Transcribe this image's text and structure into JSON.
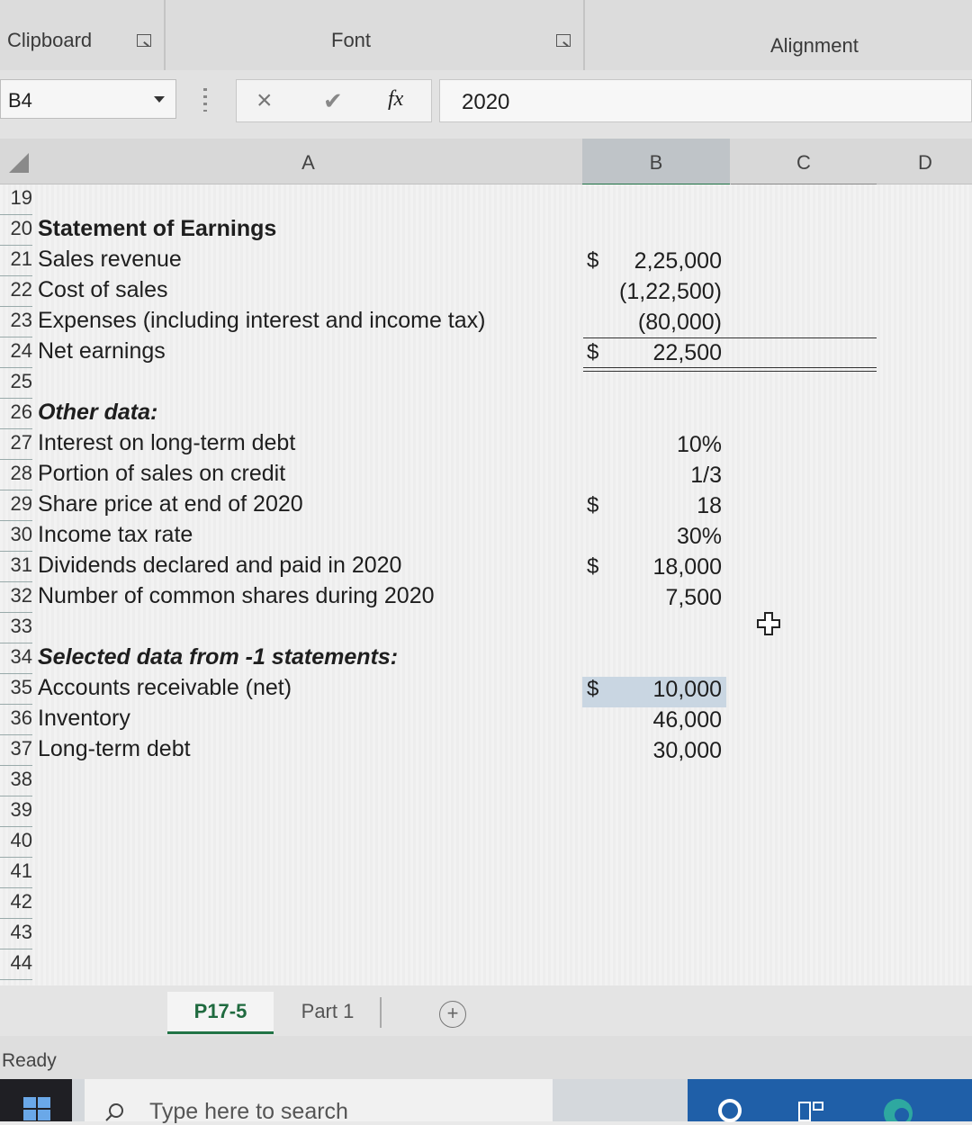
{
  "ribbon": {
    "groups": [
      {
        "label": "Clipboard"
      },
      {
        "label": "Font"
      },
      {
        "label": "Alignment"
      }
    ]
  },
  "formula_bar": {
    "name_box": "B4",
    "cancel_icon": "×",
    "enter_icon": "✔",
    "fx_icon": "fx",
    "value": "2020"
  },
  "columns": [
    "A",
    "B",
    "C",
    "D"
  ],
  "rows": [
    {
      "num": "19",
      "label": "",
      "style": "",
      "dollar": "",
      "value": ""
    },
    {
      "num": "20",
      "label": "Statement of Earnings",
      "style": "bold",
      "dollar": "",
      "value": ""
    },
    {
      "num": "21",
      "label": "Sales revenue",
      "style": "",
      "dollar": "$",
      "value": "2,25,000"
    },
    {
      "num": "22",
      "label": "Cost of sales",
      "style": "",
      "dollar": "",
      "value": "(1,22,500)"
    },
    {
      "num": "23",
      "label": "Expenses (including interest and income tax)",
      "style": "",
      "dollar": "",
      "value": "(80,000)"
    },
    {
      "num": "24",
      "label": "Net earnings",
      "style": "",
      "dollar": "$",
      "value": "22,500"
    },
    {
      "num": "25",
      "label": "",
      "style": "",
      "dollar": "",
      "value": ""
    },
    {
      "num": "26",
      "label": "Other data:",
      "style": "bi",
      "dollar": "",
      "value": ""
    },
    {
      "num": "27",
      "label": "Interest on long-term debt",
      "style": "",
      "dollar": "",
      "value": "10%"
    },
    {
      "num": "28",
      "label": "Portion of sales on credit",
      "style": "",
      "dollar": "",
      "value": "1/3"
    },
    {
      "num": "29",
      "label": "Share price at end of 2020",
      "style": "",
      "dollar": "$",
      "value": "18"
    },
    {
      "num": "30",
      "label": "Income tax rate",
      "style": "",
      "dollar": "",
      "value": "30%"
    },
    {
      "num": "31",
      "label": "Dividends declared and paid in 2020",
      "style": "",
      "dollar": "$",
      "value": "18,000"
    },
    {
      "num": "32",
      "label": "Number of common shares during 2020",
      "style": "",
      "dollar": "",
      "value": "7,500"
    },
    {
      "num": "33",
      "label": "",
      "style": "",
      "dollar": "",
      "value": ""
    },
    {
      "num": "34",
      "label": "Selected data from -1 statements:",
      "style": "bi",
      "dollar": "",
      "value": ""
    },
    {
      "num": "35",
      "label": "Accounts receivable (net)",
      "style": "",
      "dollar": "$",
      "value": "10,000"
    },
    {
      "num": "36",
      "label": "Inventory",
      "style": "",
      "dollar": "",
      "value": "46,000"
    },
    {
      "num": "37",
      "label": "Long-term debt",
      "style": "",
      "dollar": "",
      "value": "30,000"
    },
    {
      "num": "38",
      "label": "",
      "style": "",
      "dollar": "",
      "value": ""
    },
    {
      "num": "39",
      "label": "",
      "style": "",
      "dollar": "",
      "value": ""
    },
    {
      "num": "40",
      "label": "",
      "style": "",
      "dollar": "",
      "value": ""
    },
    {
      "num": "41",
      "label": "",
      "style": "",
      "dollar": "",
      "value": ""
    },
    {
      "num": "42",
      "label": "",
      "style": "",
      "dollar": "",
      "value": ""
    },
    {
      "num": "43",
      "label": "",
      "style": "",
      "dollar": "",
      "value": ""
    },
    {
      "num": "44",
      "label": "",
      "style": "",
      "dollar": "",
      "value": ""
    }
  ],
  "sheet_tabs": [
    {
      "label": "P17-5",
      "active": true
    },
    {
      "label": "Part 1",
      "active": false
    }
  ],
  "add_sheet_icon": "+",
  "status": "Ready",
  "taskbar": {
    "search_placeholder": "Type here to search"
  },
  "colors": {
    "accent_green": "#217346",
    "selection_blue": "#c9d6e2"
  }
}
